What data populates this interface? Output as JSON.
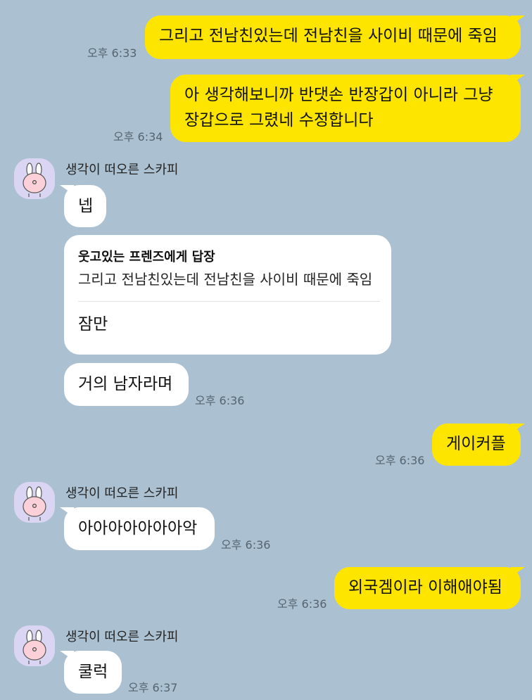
{
  "colors": {
    "background": "#abc1d1",
    "my_bubble": "#fee500",
    "their_bubble": "#ffffff",
    "avatar_bg": "#dad5f2"
  },
  "sender_name": "생각이 떠오른 스카피",
  "messages": [
    {
      "from": "me",
      "text": "그리고 전남친있는데 전남친을 사이비 때문에 죽임",
      "time": "오후 6:33"
    },
    {
      "from": "me",
      "lines": [
        "아 생각해보니까 반댓손 반장갑이 아니라 그냥",
        "장갑으로 그렸네 수정합니다"
      ],
      "time": "오후 6:34"
    },
    {
      "from": "them",
      "text": "넵"
    },
    {
      "from": "them",
      "reply_header": "웃고있는 프렌즈에게 답장",
      "reply_quote": "그리고 전남친있는데 전남친을 사이비 때문에 죽임",
      "text": "잠만"
    },
    {
      "from": "them",
      "text": "거의 남자라며",
      "time": "오후 6:36"
    },
    {
      "from": "me",
      "text": "게이커플",
      "time": "오후 6:36"
    },
    {
      "from": "them",
      "text": "아아아아아아아악",
      "time": "오후 6:36"
    },
    {
      "from": "me",
      "text": "외국겜이라 이해애야됨",
      "time": "오후 6:36"
    },
    {
      "from": "them",
      "text": "쿨럭",
      "time": "오후 6:37"
    }
  ]
}
